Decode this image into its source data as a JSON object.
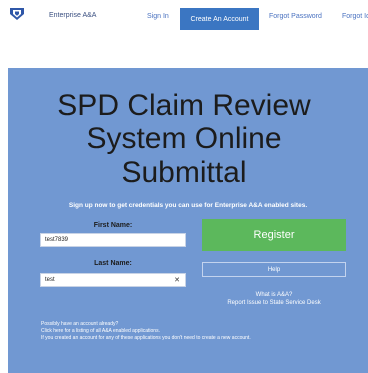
{
  "header": {
    "brand": "Enterprise A&A",
    "brand_icon": "shield-icon",
    "nav": {
      "sign_in": "Sign In",
      "create_account": "Create An Account",
      "forgot_password": "Forgot Password",
      "forgot_id": "Forgot Id"
    },
    "active_color": "#3b76c2"
  },
  "hero": {
    "title_line1": "SPD Claim Review",
    "title_line2": "System Online",
    "title_line3": "Submittal",
    "signup_note": "Sign up now to get credentials you can use for Enterprise A&A enabled sites."
  },
  "form": {
    "first_name_label": "First Name:",
    "first_name_value": "test7839",
    "last_name_label": "Last Name:",
    "last_name_value": "test"
  },
  "actions": {
    "register": "Register",
    "help": "Help",
    "what_is": "What is A&A?",
    "report_issue": "Report Issue to State Service Desk"
  },
  "footer": {
    "line1": "Possibly have an account already?",
    "line2": "Click here for a listing of all A&A enabled applications.",
    "line3": "If you created an account for any of these applications you don't need to create a new account."
  },
  "colors": {
    "panel": "#7198d2",
    "register": "#5cb85c"
  }
}
